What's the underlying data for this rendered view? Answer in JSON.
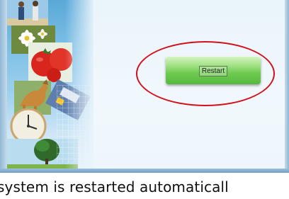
{
  "dialog": {
    "restart_button_label": "Restart"
  },
  "caption": {
    "text": "system is restarted automaticall"
  },
  "colors": {
    "highlight_ring": "#d0101b",
    "button_green": "#6fcb52",
    "frame_blue": "#8fb7d4"
  }
}
